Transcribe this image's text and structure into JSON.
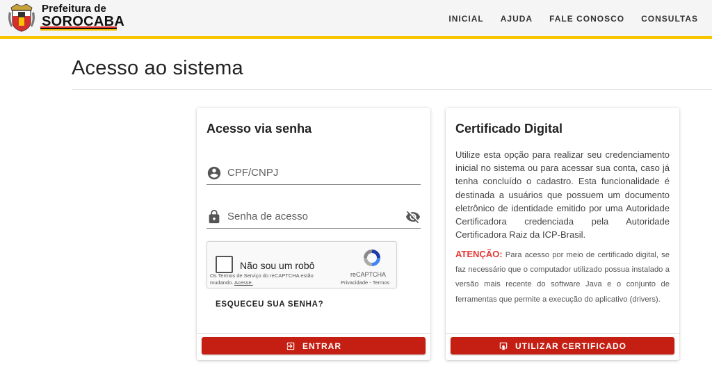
{
  "header": {
    "brand_line1": "Prefeitura de",
    "brand_line2": "SOROCABA",
    "stripe_colors": [
      "#e53935",
      "#111111",
      "#f6c500"
    ],
    "accent_color": "#f6c500",
    "nav": [
      {
        "label": "INICIAL"
      },
      {
        "label": "AJUDA"
      },
      {
        "label": "FALE CONOSCO"
      },
      {
        "label": "CONSULTAS"
      }
    ]
  },
  "page": {
    "title": "Acesso ao sistema"
  },
  "login": {
    "title": "Acesso via senha",
    "cpf_placeholder": "CPF/CNPJ",
    "cpf_icon": "account-circle-icon",
    "password_placeholder": "Senha de acesso",
    "password_icon": "lock-icon",
    "visibility_icon": "visibility-off-icon",
    "recaptcha": {
      "label": "Não sou um robô",
      "terms_text": "Os Termos de Serviço do reCAPTCHA estão mudando.",
      "terms_link": "Acesse.",
      "brand": "reCAPTCHA",
      "privacy": "Privacidade - Termos"
    },
    "forgot_label": "ESQUECEU SUA SENHA?",
    "submit_label": "ENTRAR",
    "submit_icon": "login-icon",
    "button_color": "#c41f12"
  },
  "cert": {
    "title": "Certificado Digital",
    "description": "Utilize esta opção para realizar seu credenciamento inicial no sistema ou para acessar sua conta, caso já tenha concluído o cadastro. Esta funcionalidade é destinada a usuários que possuem um documento eletrônico de identidade emitido por uma Autoridade Certificadora credenciada pela Autoridade Certificadora Raiz da ICP-Brasil.",
    "warning_label": "ATENÇÃO:",
    "warning_text": " Para acesso por meio de certificado digital, se faz necessário que o computador utilizado possua instalado a versão mais recente do software Java e o conjunto de ferramentas que permite a execução do aplicativo (drivers).",
    "warning_color": "#e53935",
    "button_label": "UTILIZAR CERTIFICADO",
    "button_icon": "certificate-icon"
  }
}
